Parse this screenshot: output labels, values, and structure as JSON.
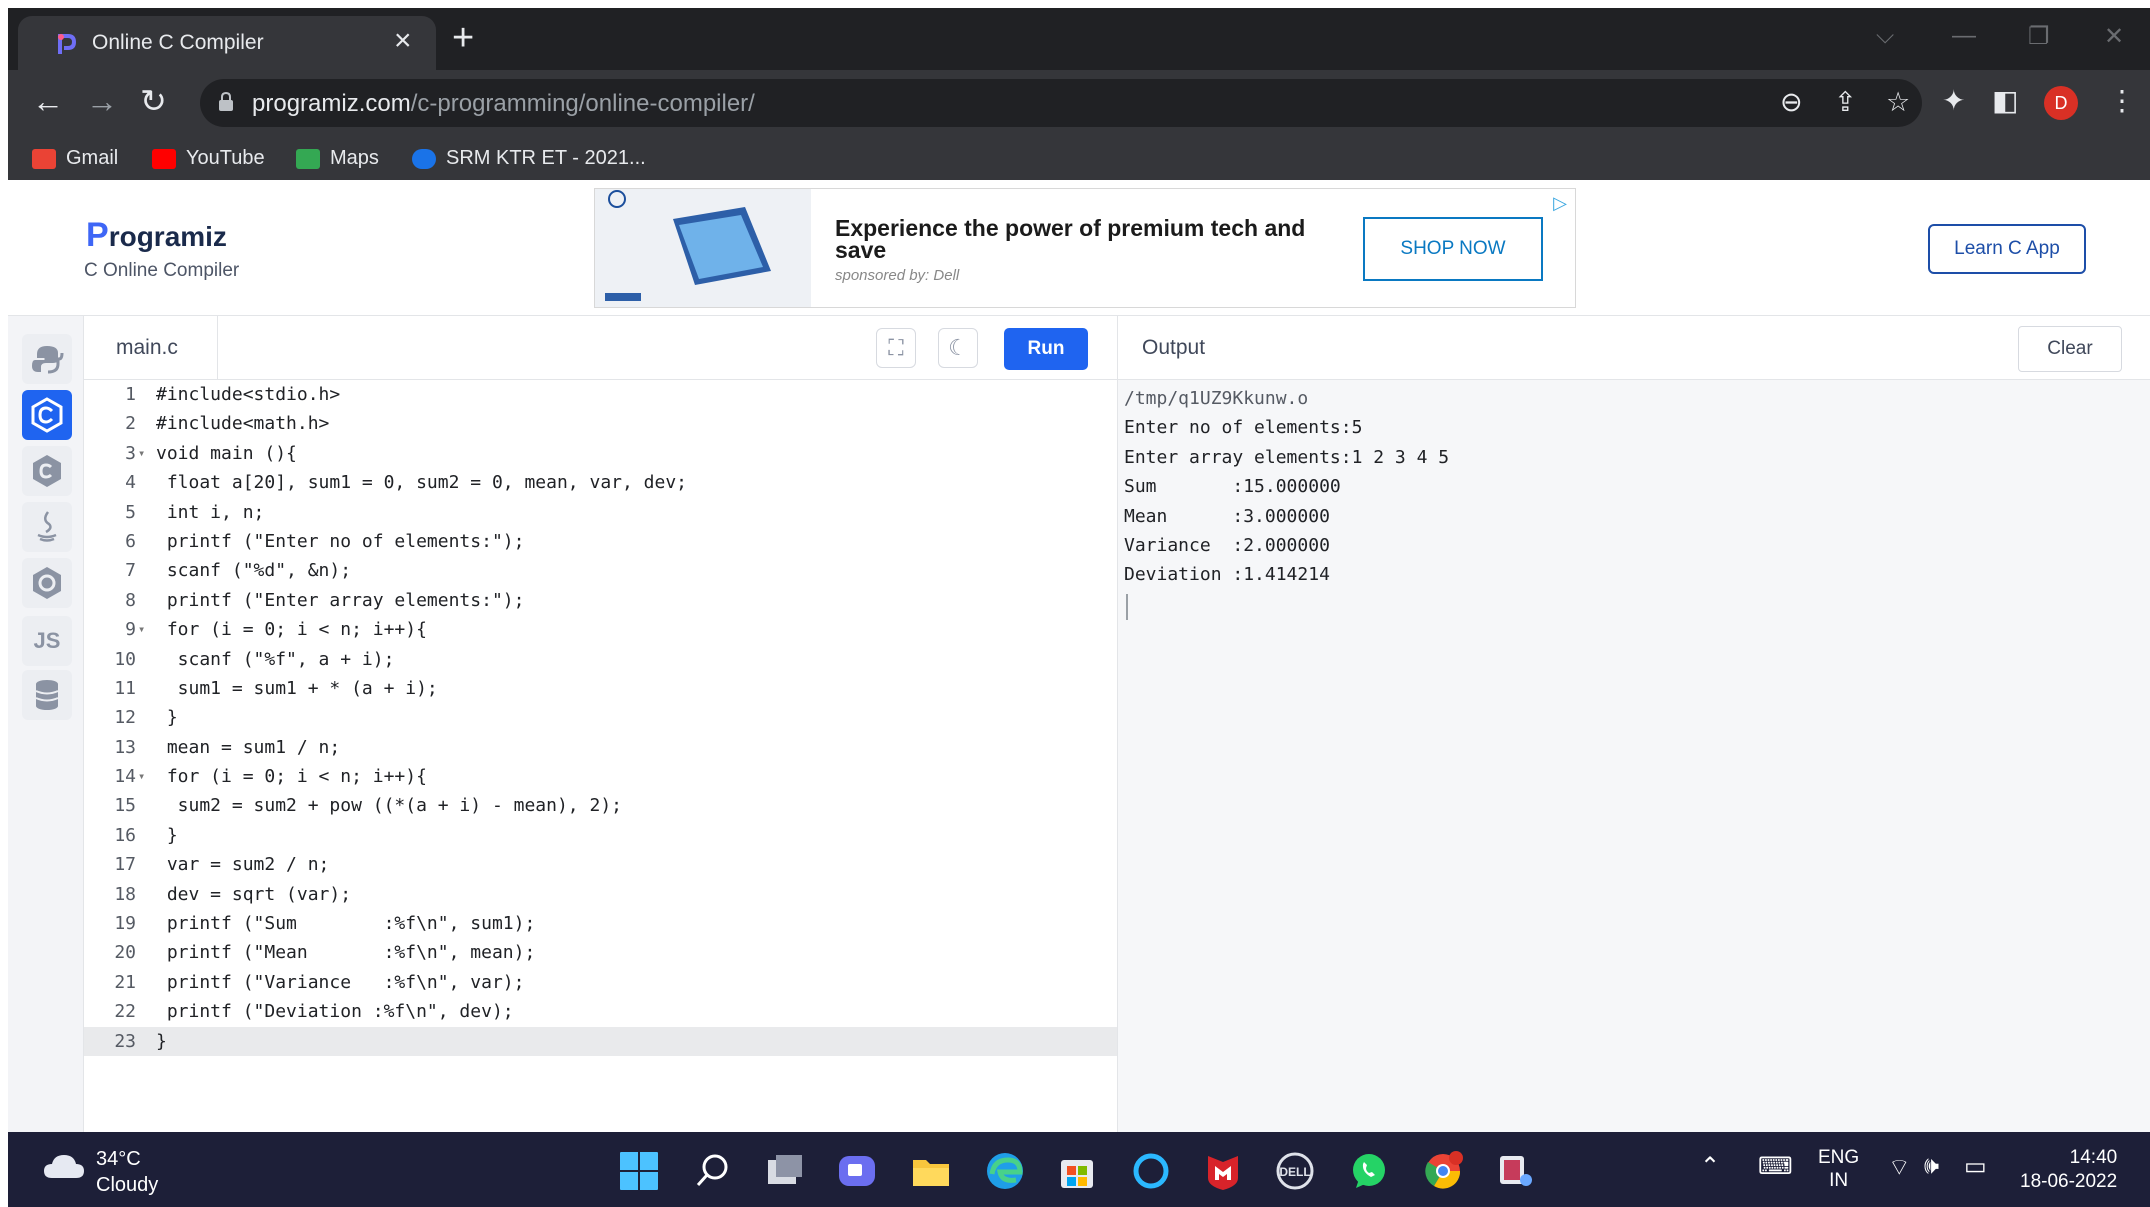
{
  "browser": {
    "tab_title": "Online C Compiler",
    "tab_close": "×",
    "new_tab": "+",
    "url_host": "programiz.com",
    "url_path": "/c-programming/online-compiler/",
    "avatar_letter": "D",
    "bookmarks": [
      {
        "label": "Gmail",
        "color": "#ea4335"
      },
      {
        "label": "YouTube",
        "color": "#ff0000"
      },
      {
        "label": "Maps",
        "color": "#34a853"
      },
      {
        "label": "SRM KTR ET - 2021...",
        "color": "#1a73e8"
      }
    ]
  },
  "site": {
    "logo_p": "P",
    "logo_rest": "rogramiz",
    "subtitle": "C Online Compiler",
    "learn_button": "Learn C App"
  },
  "ad": {
    "headline": "Experience the power of premium tech and save",
    "sponsor": "sponsored by: Dell",
    "cta": "SHOP NOW"
  },
  "rail": {
    "js_label": "JS"
  },
  "editor": {
    "file_tab": "main.c",
    "run_label": "Run",
    "lines": [
      {
        "n": "1",
        "fold": "",
        "code": "#include<stdio.h>"
      },
      {
        "n": "2",
        "fold": "",
        "code": "#include<math.h>"
      },
      {
        "n": "3",
        "fold": "▾",
        "code": "void main (){"
      },
      {
        "n": "4",
        "fold": "",
        "code": " float a[20], sum1 = 0, sum2 = 0, mean, var, dev;"
      },
      {
        "n": "5",
        "fold": "",
        "code": " int i, n;"
      },
      {
        "n": "6",
        "fold": "",
        "code": " printf (\"Enter no of elements:\");"
      },
      {
        "n": "7",
        "fold": "",
        "code": " scanf (\"%d\", &n);"
      },
      {
        "n": "8",
        "fold": "",
        "code": " printf (\"Enter array elements:\");"
      },
      {
        "n": "9",
        "fold": "▾",
        "code": " for (i = 0; i < n; i++){"
      },
      {
        "n": "10",
        "fold": "",
        "code": "  scanf (\"%f\", a + i);"
      },
      {
        "n": "11",
        "fold": "",
        "code": "  sum1 = sum1 + * (a + i);"
      },
      {
        "n": "12",
        "fold": "",
        "code": " }"
      },
      {
        "n": "13",
        "fold": "",
        "code": " mean = sum1 / n;"
      },
      {
        "n": "14",
        "fold": "▾",
        "code": " for (i = 0; i < n; i++){"
      },
      {
        "n": "15",
        "fold": "",
        "code": "  sum2 = sum2 + pow ((*(a + i) - mean), 2);"
      },
      {
        "n": "16",
        "fold": "",
        "code": " }"
      },
      {
        "n": "17",
        "fold": "",
        "code": " var = sum2 / n;"
      },
      {
        "n": "18",
        "fold": "",
        "code": " dev = sqrt (var);"
      },
      {
        "n": "19",
        "fold": "",
        "code": " printf (\"Sum        :%f\\n\", sum1);"
      },
      {
        "n": "20",
        "fold": "",
        "code": " printf (\"Mean       :%f\\n\", mean);"
      },
      {
        "n": "21",
        "fold": "",
        "code": " printf (\"Variance   :%f\\n\", var);"
      },
      {
        "n": "22",
        "fold": "",
        "code": " printf (\"Deviation :%f\\n\", dev);"
      },
      {
        "n": "23",
        "fold": "",
        "code": "}"
      }
    ]
  },
  "output": {
    "title": "Output",
    "clear_label": "Clear",
    "path_line": "/tmp/q1UZ9Kkunw.o",
    "lines": [
      "Enter no of elements:5",
      "Enter array elements:1 2 3 4 5",
      "Sum       :15.000000",
      "Mean      :3.000000",
      "Variance  :2.000000",
      "Deviation :1.414214"
    ]
  },
  "taskbar": {
    "temperature": "34°C",
    "condition": "Cloudy",
    "lang_top": "ENG",
    "lang_bottom": "IN",
    "time": "14:40",
    "date": "18-06-2022"
  }
}
